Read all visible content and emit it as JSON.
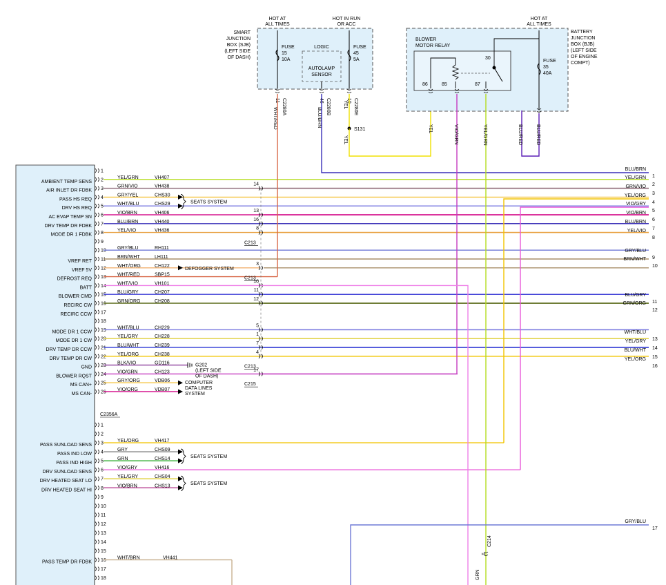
{
  "modules": {
    "sjb": {
      "label": [
        "SMART",
        "JUNCTION",
        "BOX (SJB)",
        "(LEFT SIDE",
        "OF DASH)"
      ]
    },
    "bjb": {
      "label": [
        "BATTERY",
        "JUNCTION",
        "BOX (BJB)",
        "(LEFT SIDE",
        "OF ENGINE",
        "COMPT)"
      ]
    },
    "relay": {
      "label": [
        "BLOWER",
        "MOTOR RELAY"
      ],
      "pins": [
        "86",
        "85",
        "87",
        "30"
      ]
    }
  },
  "power_labels": {
    "hot_at_all_times": [
      "HOT AT",
      "ALL TIMES"
    ],
    "hot_in_run": [
      "HOT IN RUN",
      "OR ACC"
    ]
  },
  "fuses": [
    {
      "label": [
        "FUSE",
        "15",
        "10A"
      ]
    },
    {
      "label": [
        "FUSE",
        "45",
        "5A"
      ]
    },
    {
      "label": [
        "FUSE",
        "35",
        "40A"
      ]
    }
  ],
  "logic": {
    "title": "LOGIC",
    "sensor": [
      "AUTOLAMP",
      "SENSOR"
    ]
  },
  "top_connectors": [
    {
      "pin": "11",
      "conn": "C2280A",
      "wire": "WHT/RED"
    },
    {
      "pin": "46",
      "conn": "C2280B",
      "wire": "BLU/BRN"
    },
    {
      "pin": "10",
      "conn": "C2280E",
      "wire": "YEL"
    }
  ],
  "splice": {
    "label": "S131"
  },
  "vertical_wires": [
    "YEL",
    "YEL",
    "VIO/GRN",
    "YEL/GRN",
    "BLU/RED",
    "BLU/RED"
  ],
  "left_pins_a": [
    {
      "n": "1",
      "func": "",
      "color": "",
      "circuit": ""
    },
    {
      "n": "2",
      "func": "AMBIENT TEMP SENS",
      "color": "YEL/GRN",
      "circuit": "VH407"
    },
    {
      "n": "3",
      "func": "AIR INLET DR FDBK",
      "color": "GRN/VIO",
      "circuit": "VH438"
    },
    {
      "n": "4",
      "func": "PASS HS REQ",
      "color": "GRY/YEL",
      "circuit": "CHS30"
    },
    {
      "n": "5",
      "func": "DRV HS REQ",
      "color": "WHT/BLU",
      "circuit": "CHS29"
    },
    {
      "n": "6",
      "func": "AC EVAP TEMP SN",
      "color": "VIO/BRN",
      "circuit": "VH406"
    },
    {
      "n": "7",
      "func": "DRV TEMP DR FDBK",
      "color": "BLU/BRN",
      "circuit": "VH440"
    },
    {
      "n": "8",
      "func": "MODE DR 1 FDBK",
      "color": "YEL/VIO",
      "circuit": "VH436"
    },
    {
      "n": "9",
      "func": "",
      "color": "",
      "circuit": ""
    },
    {
      "n": "10",
      "func": "",
      "color": "GRY/BLU",
      "circuit": "RH111"
    },
    {
      "n": "11",
      "func": "VREF RET",
      "color": "BRN/WHT",
      "circuit": "LH111"
    },
    {
      "n": "12",
      "func": "VREF 5V",
      "color": "WHT/ORG",
      "circuit": "CH122"
    },
    {
      "n": "13",
      "func": "DEFROST REQ",
      "color": "WHT/RED",
      "circuit": "SBP15"
    },
    {
      "n": "14",
      "func": "BATT",
      "color": "WHT/VIO",
      "circuit": "VH101"
    },
    {
      "n": "15",
      "func": "BLOWER CMD",
      "color": "BLU/GRY",
      "circuit": "CH207"
    },
    {
      "n": "16",
      "func": "RECIRC CW",
      "color": "GRN/ORG",
      "circuit": "CH208"
    },
    {
      "n": "17",
      "func": "RECIRC CCW",
      "color": "",
      "circuit": ""
    },
    {
      "n": "18",
      "func": "",
      "color": "",
      "circuit": ""
    },
    {
      "n": "19",
      "func": "MODE DR 1 CCW",
      "color": "WHT/BLU",
      "circuit": "CH229"
    },
    {
      "n": "20",
      "func": "MODE DR 1 CW",
      "color": "YEL/GRY",
      "circuit": "CH228"
    },
    {
      "n": "21",
      "func": "DRV TEMP DR CCW",
      "color": "BLU/WHT",
      "circuit": "CH239"
    },
    {
      "n": "22",
      "func": "DRV TEMP DR CW",
      "color": "YEL/ORG",
      "circuit": "CH238"
    },
    {
      "n": "23",
      "func": "GND",
      "color": "BLK/VIO",
      "circuit": "GD116"
    },
    {
      "n": "24",
      "func": "BLOWER RQST",
      "color": "VIO/GRN",
      "circuit": "CH123"
    },
    {
      "n": "25",
      "func": "MS CAN+",
      "color": "GRY/ORG",
      "circuit": "VDB06"
    },
    {
      "n": "26",
      "func": "MS CAN-",
      "color": "VIO/ORG",
      "circuit": "VDB07"
    }
  ],
  "connector_a_label": "C2356A",
  "left_pins_b": [
    {
      "n": "1",
      "func": "",
      "color": "",
      "circuit": ""
    },
    {
      "n": "2",
      "func": "",
      "color": "",
      "circuit": ""
    },
    {
      "n": "3",
      "func": "PASS SUNLOAD SENS",
      "color": "YEL/ORG",
      "circuit": "VH417"
    },
    {
      "n": "4",
      "func": "PASS IND LOW",
      "color": "GRY",
      "circuit": "CHS09"
    },
    {
      "n": "5",
      "func": "PASS IND HIGH",
      "color": "GRN",
      "circuit": "CHS14"
    },
    {
      "n": "6",
      "func": "DRV SUNLOAD SENS",
      "color": "VIO/GRY",
      "circuit": "VH416"
    },
    {
      "n": "7",
      "func": "DRV HEATED SEAT LO",
      "color": "YEL/GRY",
      "circuit": "CHS04"
    },
    {
      "n": "8",
      "func": "DRV HEATED SEAT HI",
      "color": "VIO/BRN",
      "circuit": "CHS13"
    },
    {
      "n": "9",
      "func": "",
      "color": "",
      "circuit": ""
    },
    {
      "n": "10",
      "func": "",
      "color": "",
      "circuit": ""
    },
    {
      "n": "11",
      "func": "",
      "color": "",
      "circuit": ""
    },
    {
      "n": "12",
      "func": "",
      "color": "",
      "circuit": ""
    },
    {
      "n": "13",
      "func": "",
      "color": "",
      "circuit": ""
    },
    {
      "n": "14",
      "func": "",
      "color": "",
      "circuit": ""
    },
    {
      "n": "15",
      "func": "",
      "color": "",
      "circuit": ""
    },
    {
      "n": "16",
      "func": "PASS TEMP DR FDBK",
      "color": "WHT/BRN",
      "circuit": "VH441"
    },
    {
      "n": "17",
      "func": "",
      "color": "",
      "circuit": ""
    },
    {
      "n": "18",
      "func": "",
      "color": "",
      "circuit": ""
    }
  ],
  "inline_pins": [
    "14",
    "13",
    "16",
    "8",
    "3",
    "10",
    "11",
    "12",
    "5",
    "1",
    "7",
    "4",
    "17"
  ],
  "inline_connectors": [
    "C213",
    "C213",
    "C213",
    "C215",
    "C214"
  ],
  "annotations": {
    "seats": "SEATS SYSTEM",
    "defog": "DEFOGGER SYSTEM",
    "ground": [
      "G202",
      "(LEFT SIDE",
      "OF DASH)"
    ],
    "can": [
      "COMPUTER",
      "DATA LINES",
      "SYSTEM"
    ]
  },
  "right_wires": [
    {
      "color": "BLU/BRN",
      "pin": "1"
    },
    {
      "color": "YEL/GRN",
      "pin": "2"
    },
    {
      "color": "GRN/VIO",
      "pin": "3"
    },
    {
      "color": "YEL/ORG",
      "pin": "4"
    },
    {
      "color": "VIO/GRY",
      "pin": "5"
    },
    {
      "color": "VIO/BRN",
      "pin": "6"
    },
    {
      "color": "BLU/BRN",
      "pin": "7"
    },
    {
      "color": "YEL/VIO",
      "pin": "8"
    },
    {
      "color": "GRY/BLU",
      "pin": "9"
    },
    {
      "color": "BRN/WHT",
      "pin": "10"
    },
    {
      "color": "BLU/GRY",
      "pin": "11"
    },
    {
      "color": "GRN/ORG",
      "pin": "12"
    },
    {
      "color": "WHT/BLU",
      "pin": "13"
    },
    {
      "color": "YEL/GRY",
      "pin": "14"
    },
    {
      "color": "BLU/WHT",
      "pin": "15"
    },
    {
      "color": "YEL/ORG",
      "pin": "16"
    },
    {
      "color": "GRY/BLU",
      "pin": "17"
    }
  ],
  "bottom_wire": "GRN",
  "wire_colors": {
    "yel": "#f2e21a",
    "yelgrn": "#b4dd1e",
    "grnvio": "#8e6a78",
    "grayorg": "#f4c542",
    "whtblu": "#7b7be0",
    "viobrn": "#d6178f",
    "bluebrn": "#3a2fb8",
    "yelvio": "#e8a040",
    "grayblu": "#6f79d6",
    "brnwht": "#a88f6a",
    "whtorg": "#f0b070",
    "whtred": "#d86848",
    "whtvio": "#ee7fe8",
    "blugry": "#3b3bd6",
    "grnorg": "#5b6b1a",
    "yelgry": "#e0d040",
    "bluwht": "#3e48d8",
    "yelorg": "#f2c400",
    "blkvio": "#8b3a9a",
    "viogrn": "#c43ac0",
    "violet": "#b4388c",
    "green": "#2aaa2a",
    "gray": "#8a8a8a",
    "whtbrn": "#c8b090",
    "vioGry": "#e858d8",
    "purple": "#6a1fc0",
    "orange": "#f5a000",
    "blured": "#5a1db5",
    "module": "#dff0fa"
  }
}
